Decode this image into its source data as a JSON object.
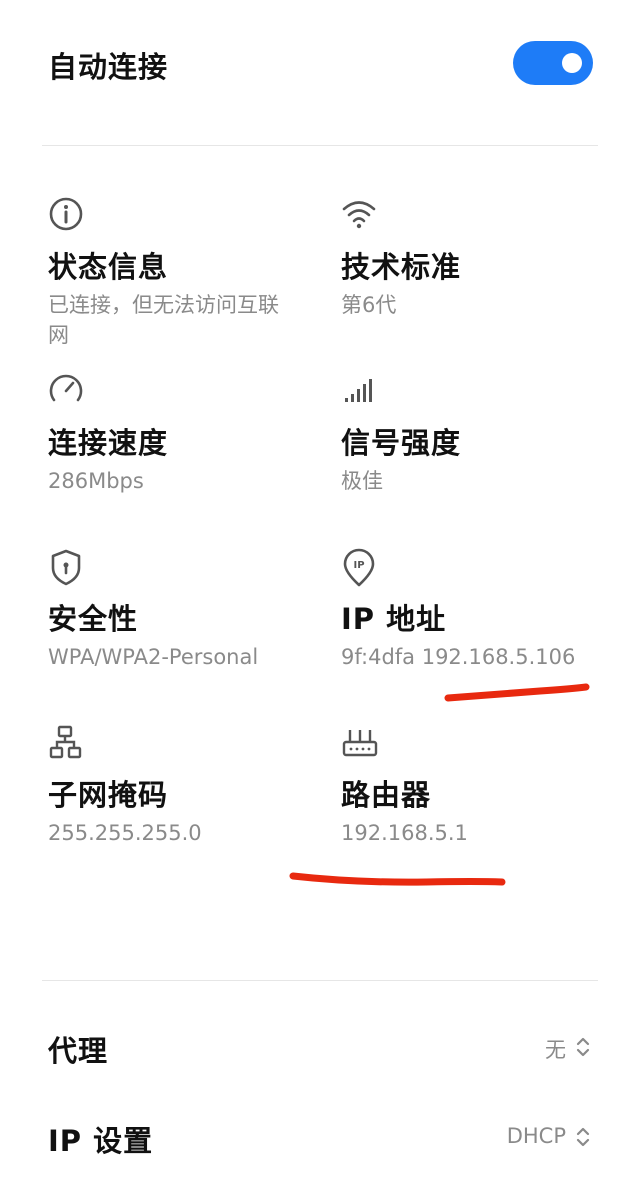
{
  "auto_connect": {
    "label": "自动连接",
    "enabled": true,
    "accent": "#1e7cf7"
  },
  "info": [
    {
      "icon": "info-icon",
      "title": "状态信息",
      "value": "已连接，但无法访问互联网"
    },
    {
      "icon": "wifi-icon",
      "title": "技术标准",
      "value": "第6代"
    },
    {
      "icon": "speedometer-icon",
      "title": "连接速度",
      "value": "286Mbps"
    },
    {
      "icon": "signal-bars-icon",
      "title": "信号强度",
      "value": "极佳"
    },
    {
      "icon": "shield-icon",
      "title": "安全性",
      "value": "WPA/WPA2-Personal"
    },
    {
      "icon": "ip-pin-icon",
      "title": "IP 地址",
      "value": "9f:4dfa 192.168.5.106"
    },
    {
      "icon": "network-topology-icon",
      "title": "子网掩码",
      "value": "255.255.255.0"
    },
    {
      "icon": "router-icon",
      "title": "路由器",
      "value": "192.168.5.1"
    }
  ],
  "proxy": {
    "label": "代理",
    "value": "无"
  },
  "ip_settings": {
    "label": "IP 设置",
    "value": "DHCP"
  },
  "annotation_color": "#e8290f"
}
